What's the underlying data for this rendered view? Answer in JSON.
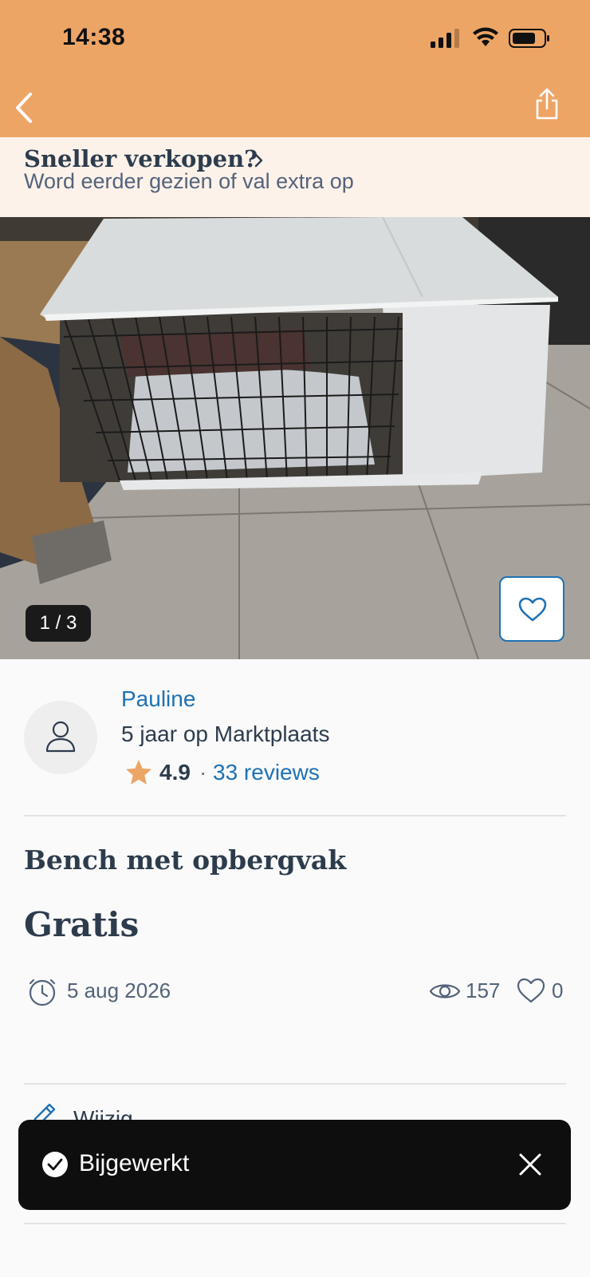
{
  "status_bar": {
    "time": "14:38"
  },
  "nav": {
    "back_icon": "chevron-left-icon",
    "share_icon": "share-icon"
  },
  "promo": {
    "title": "Sneller verkopen?",
    "subtitle": "Word eerder gezien of val extra op"
  },
  "gallery": {
    "counter": "1 / 3",
    "favorite_icon": "heart-outline-icon"
  },
  "seller": {
    "name": "Pauline",
    "member_since": "5 jaar op Marktplaats",
    "rating": "4.9",
    "separator": "·",
    "reviews": "33 reviews"
  },
  "listing": {
    "title": "Bench met opbergvak",
    "price": "Gratis",
    "date": "5 aug 2026",
    "views": "157",
    "favorites": "0"
  },
  "actions": {
    "edit_label": "Wijzig"
  },
  "toast": {
    "message": "Bijgewerkt"
  },
  "colors": {
    "header": "#eda566",
    "link": "#1e71b4",
    "text": "#2d3c4d",
    "star": "#eda566"
  }
}
